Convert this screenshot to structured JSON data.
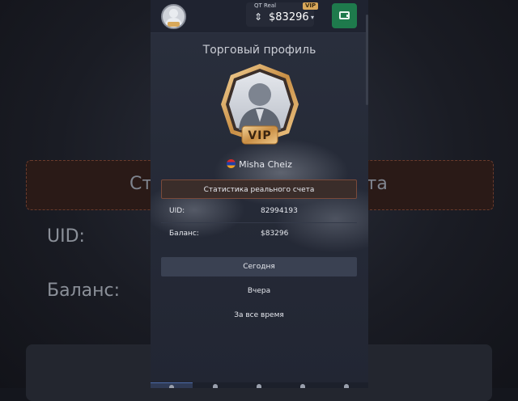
{
  "background": {
    "heading_fragment_left": "Ста",
    "heading_fragment_right": "чета",
    "uid_label": "UID:",
    "balance_label": "Баланс:"
  },
  "topbar": {
    "account_type": "QT Real",
    "vip_label": "VIP",
    "balance": "$83296",
    "arrows": "⇕",
    "caret": "▾"
  },
  "profile": {
    "title": "Торговый профиль",
    "badge_text": "VIP",
    "username": "Misha Cheiz"
  },
  "stats": {
    "header": "Статистика реального счета",
    "rows": [
      {
        "label": "UID:",
        "value": "82994193"
      },
      {
        "label": "Баланс:",
        "value": "$83296"
      }
    ]
  },
  "periods": [
    {
      "label": "Сегодня",
      "active": true
    },
    {
      "label": "Вчера",
      "active": false
    },
    {
      "label": "За все время",
      "active": false
    }
  ],
  "colors": {
    "accent_vip": "#d9a85a",
    "wallet_green": "#1e7a4c",
    "header_border": "#7a4a3a"
  }
}
